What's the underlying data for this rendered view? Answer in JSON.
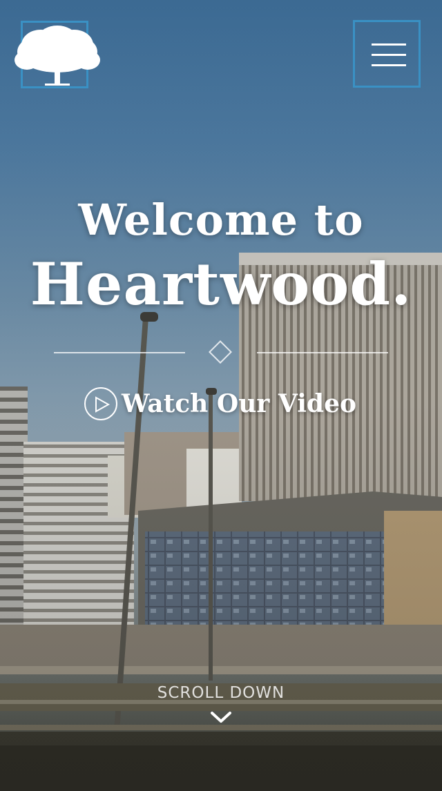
{
  "header": {
    "logo_icon": "oak-tree-icon",
    "menu_icon": "hamburger-menu-icon",
    "accent_color": "#3a91c4"
  },
  "hero": {
    "title_line1": "Welcome to",
    "title_line2": "Heartwood.",
    "divider_icon": "diamond-icon",
    "video_icon": "play-circle-icon",
    "video_label": "Watch Our Video",
    "scroll_label": "SCROLL DOWN",
    "scroll_icon": "chevron-down-icon"
  }
}
